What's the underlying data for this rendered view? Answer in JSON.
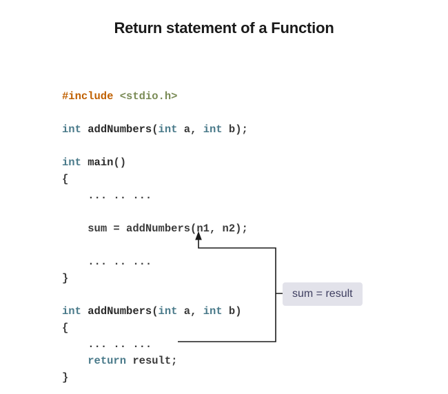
{
  "title": "Return statement of a Function",
  "code": {
    "include_kw": "#include",
    "include_hdr": "<stdio.h>",
    "proto_type": "int",
    "proto_fn": "addNumbers",
    "proto_p1_type": "int",
    "proto_p1_name": "a",
    "proto_p2_type": "int",
    "proto_p2_name": "b",
    "main_type": "int",
    "main_fn": "main",
    "dots": "... .. ...",
    "call_line": "sum = addNumbers(n1, n2);",
    "def_type": "int",
    "def_fn": "addNumbers",
    "def_p1_type": "int",
    "def_p1_name": "a",
    "def_p2_type": "int",
    "def_p2_name": "b",
    "return_kw": "return",
    "return_val": "result;"
  },
  "annotation": "sum = result"
}
